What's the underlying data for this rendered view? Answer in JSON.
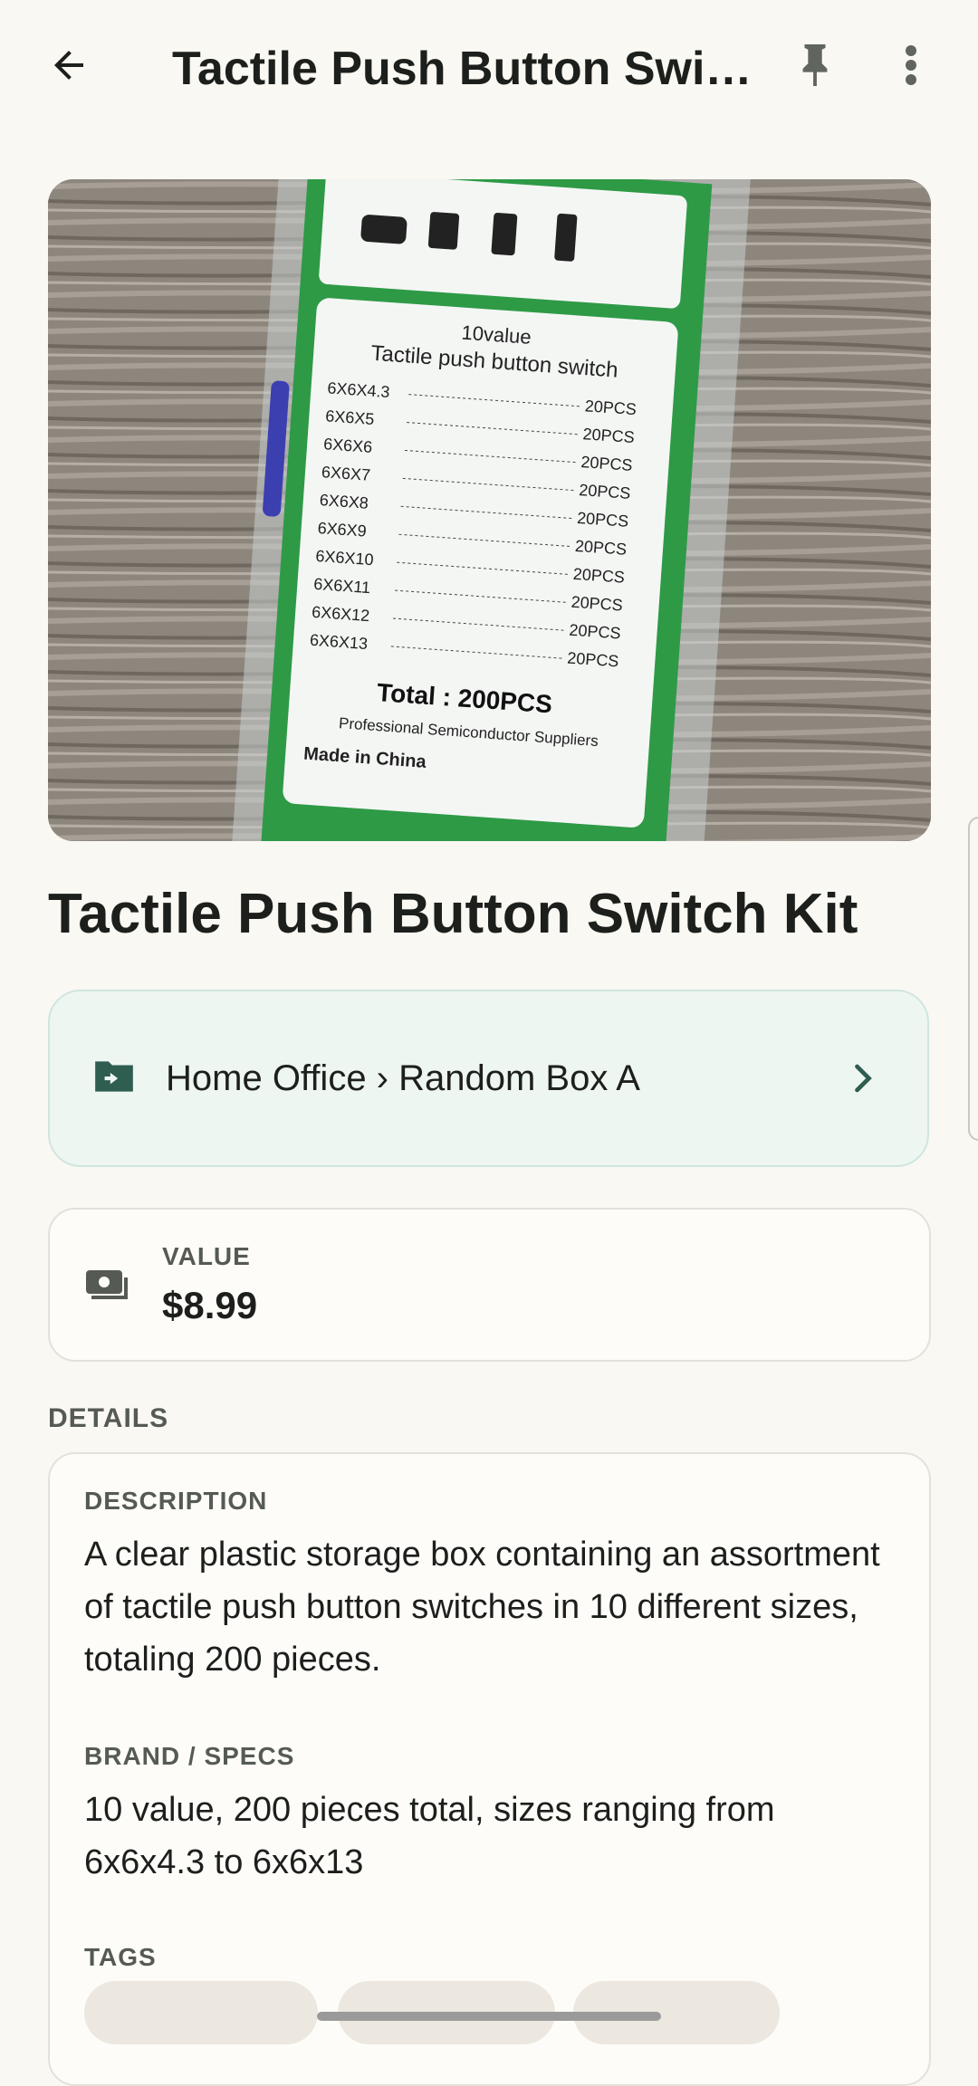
{
  "appbar": {
    "title": "Tactile Push Button Switch Kit",
    "icons": {
      "back": "arrow-back-icon",
      "pin": "pin-icon",
      "more": "more-vert-icon"
    }
  },
  "photo": {
    "box_heading_1": "10value",
    "box_heading_2": "Tactile push button switch",
    "rows": [
      {
        "size": "6X6X4.3",
        "qty": "20PCS"
      },
      {
        "size": "6X6X5",
        "qty": "20PCS"
      },
      {
        "size": "6X6X6",
        "qty": "20PCS"
      },
      {
        "size": "6X6X7",
        "qty": "20PCS"
      },
      {
        "size": "6X6X8",
        "qty": "20PCS"
      },
      {
        "size": "6X6X9",
        "qty": "20PCS"
      },
      {
        "size": "6X6X10",
        "qty": "20PCS"
      },
      {
        "size": "6X6X11",
        "qty": "20PCS"
      },
      {
        "size": "6X6X12",
        "qty": "20PCS"
      },
      {
        "size": "6X6X13",
        "qty": "20PCS"
      }
    ],
    "total": "Total : 200PCS",
    "supplier": "Professional Semiconductor Suppliers",
    "origin": "Made in China"
  },
  "item": {
    "title": "Tactile Push Button Switch Kit"
  },
  "location": {
    "path": "Home Office › Random Box A",
    "icon": "folder-move-icon",
    "accent": "#2f5d50",
    "background": "#eef6f2"
  },
  "value": {
    "label": "VALUE",
    "amount": "$8.99",
    "icon": "payments-icon"
  },
  "details": {
    "section_label": "DETAILS",
    "description_label": "DESCRIPTION",
    "description": "A clear plastic storage box containing an assortment of tactile push button switches in 10 different sizes, totaling 200 pieces.",
    "brand_label": "BRAND / SPECS",
    "brand": "10 value, 200 pieces total, sizes ranging from 6x6x4.3 to 6x6x13",
    "tags_label": "TAGS"
  }
}
